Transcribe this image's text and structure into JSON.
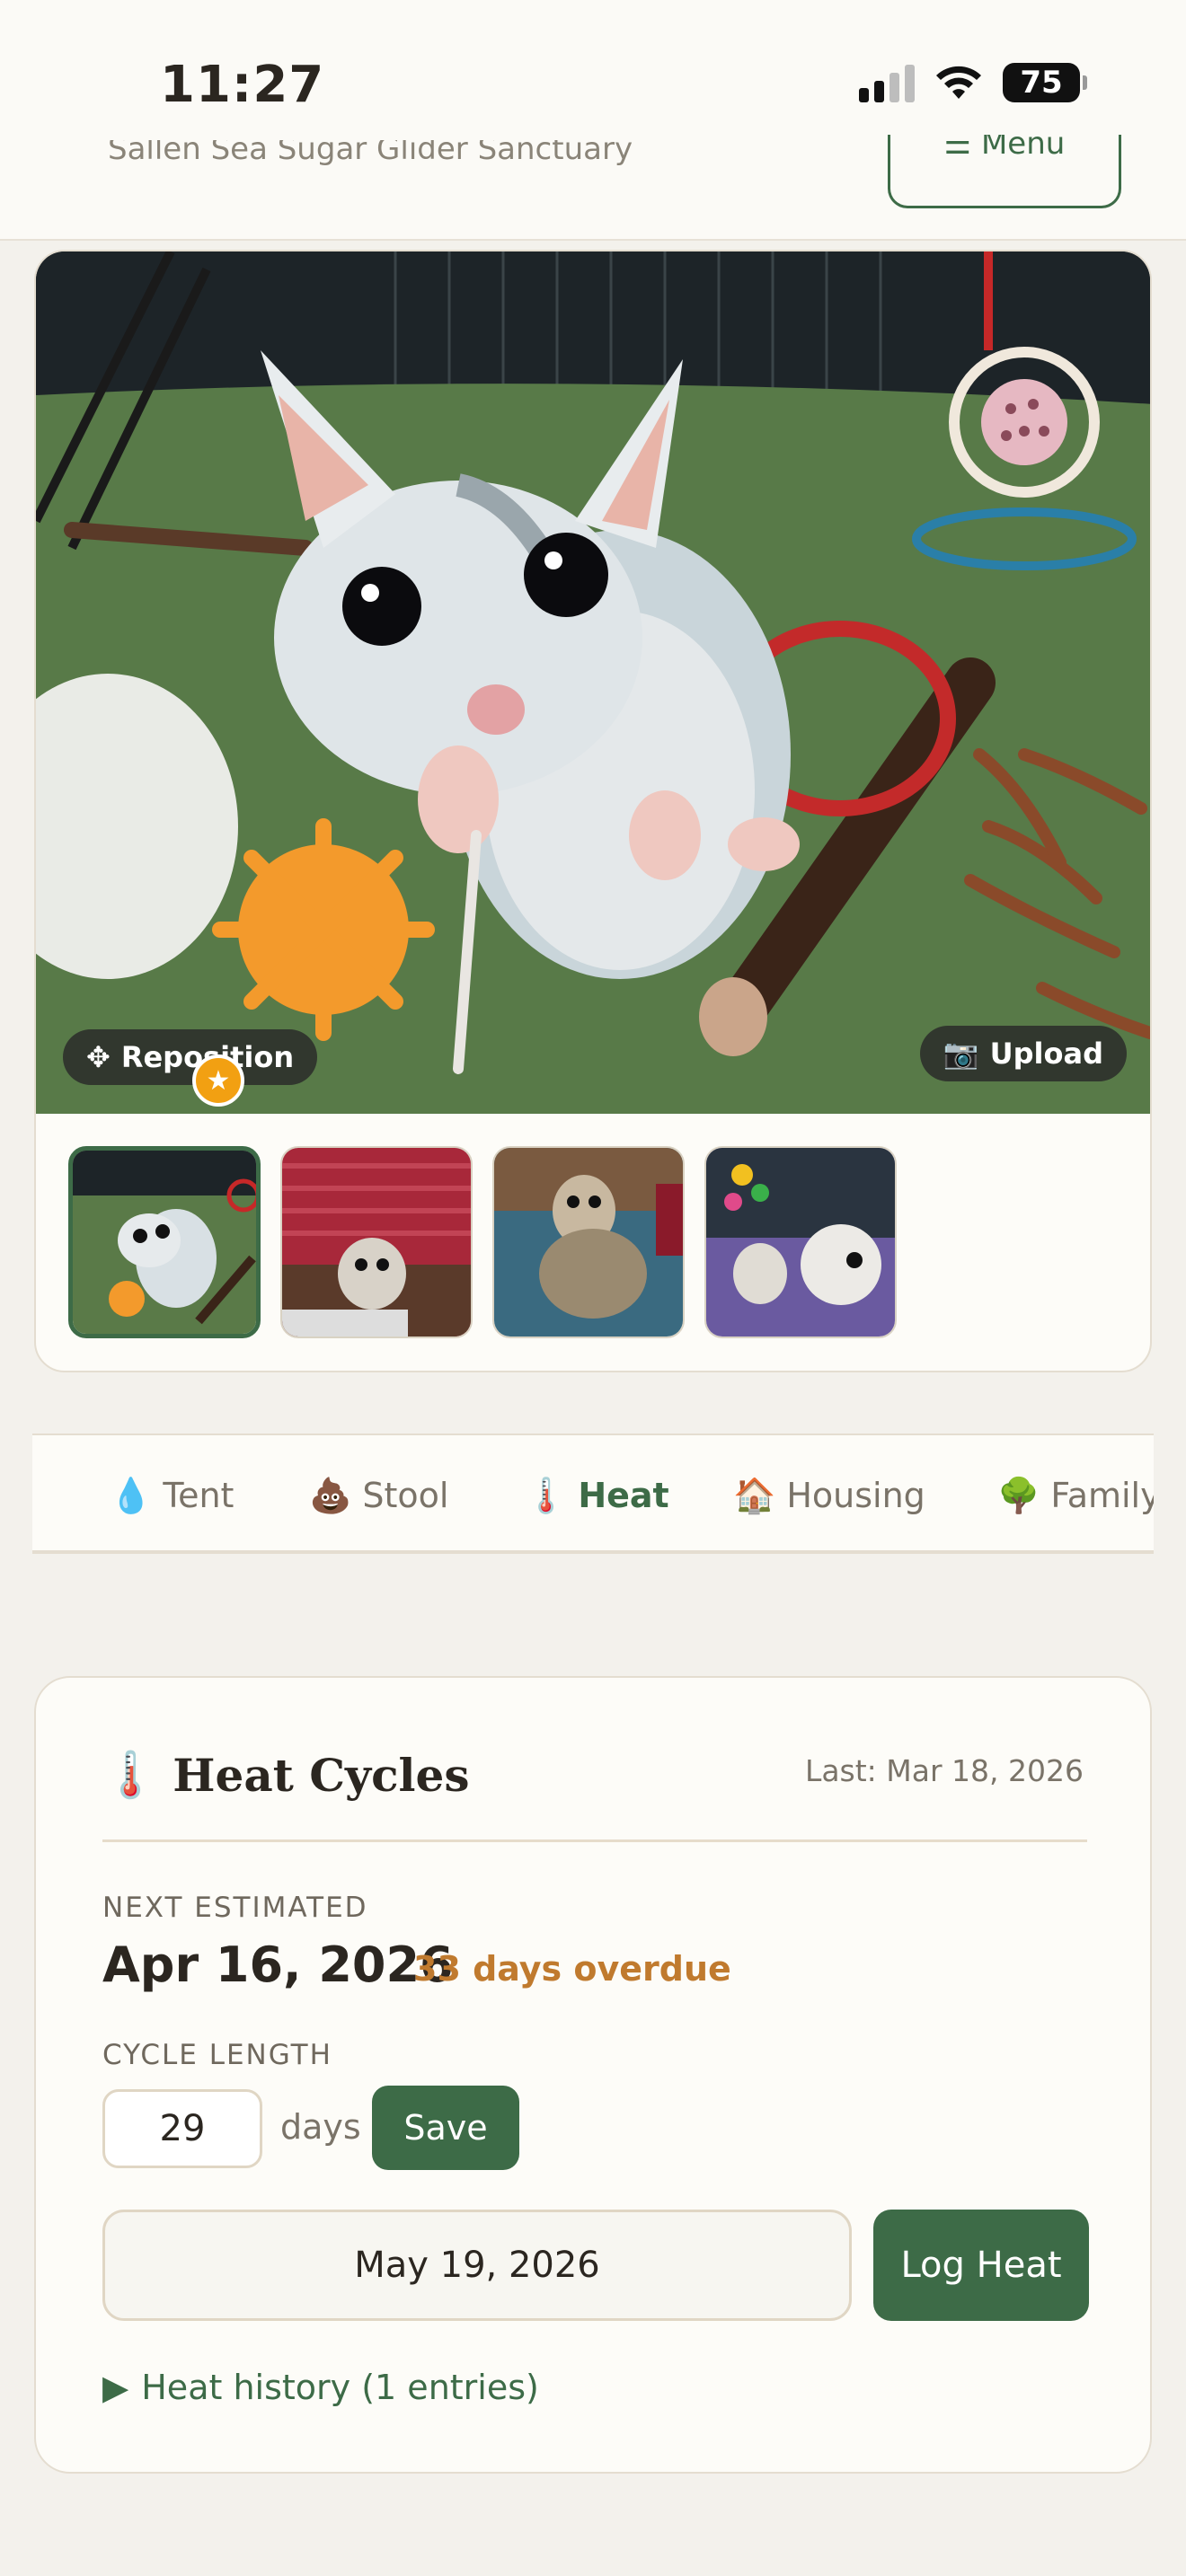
{
  "status_bar": {
    "time": "11:27",
    "battery": "75"
  },
  "header": {
    "title_clipped": "Sallen Sea Sugar Glider Sanctuary",
    "menu_label": "☰ Menu"
  },
  "photo": {
    "reposition_label": "Reposition",
    "upload_label": "Upload",
    "thumbnails": [
      {
        "name": "thumb-1",
        "selected": true,
        "primary": true
      },
      {
        "name": "thumb-2",
        "selected": false
      },
      {
        "name": "thumb-3",
        "selected": false
      },
      {
        "name": "thumb-4",
        "selected": false
      }
    ]
  },
  "tabs": [
    {
      "emoji": "💧",
      "label": "Tent",
      "active": false
    },
    {
      "emoji": "💩",
      "label": "Stool",
      "active": false
    },
    {
      "emoji": "🌡️",
      "label": "Heat",
      "active": true
    },
    {
      "emoji": "🏠",
      "label": "Housing",
      "active": false
    },
    {
      "emoji": "🌳",
      "label": "Family",
      "active": false
    }
  ],
  "heat": {
    "icon": "🌡️",
    "title": "Heat Cycles",
    "last": "Last: Mar 18, 2026",
    "next_label": "NEXT ESTIMATED",
    "next_date": "Apr 16, 2026",
    "overdue": "33 days overdue",
    "cycle_label": "CYCLE LENGTH",
    "cycle_value": "29",
    "days_label": "days",
    "save_label": "Save",
    "date_value": "May 19, 2026",
    "log_label": "Log Heat",
    "history_label": "Heat history (1 entries)"
  },
  "colors": {
    "accent": "#3d6b47",
    "overdue": "#c07a2e",
    "background": "#f3f1ec",
    "card": "#fdfcf8",
    "star_badge": "#f2a012"
  }
}
